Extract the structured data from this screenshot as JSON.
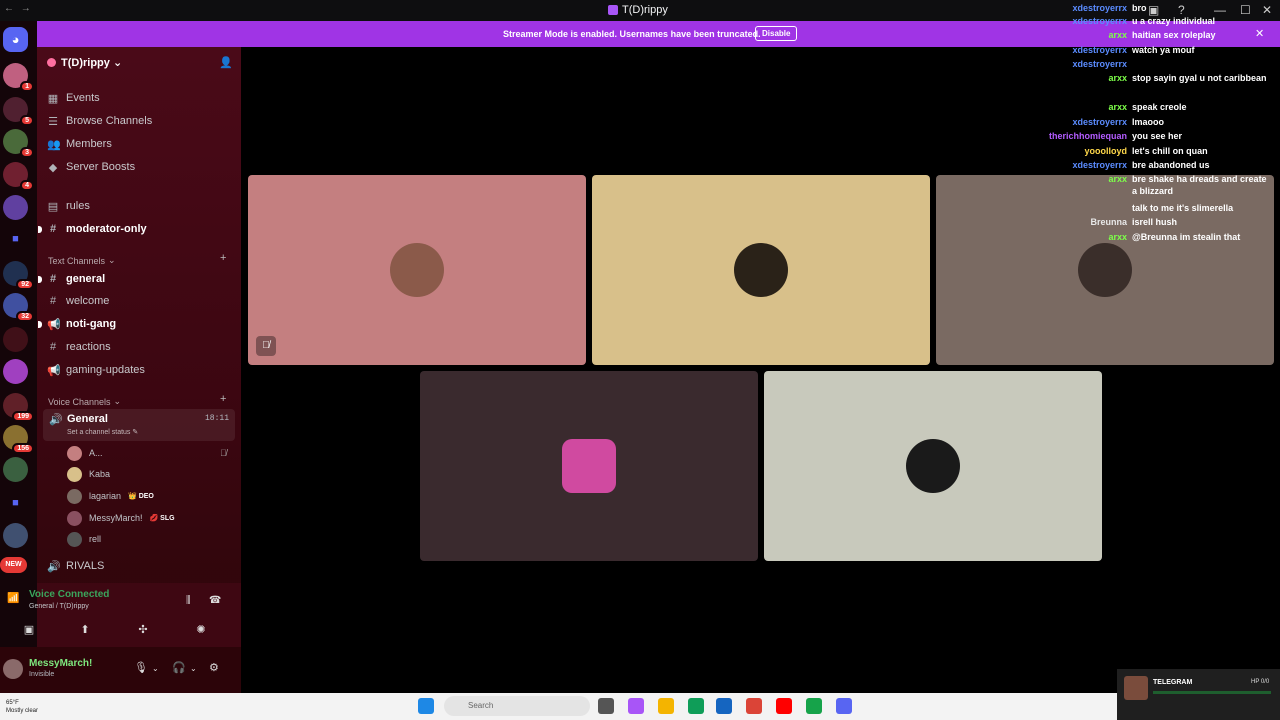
{
  "window": {
    "title": "T(D)rippy"
  },
  "banner": {
    "text": "Streamer Mode is enabled. Usernames have been truncated.",
    "button": "Disable"
  },
  "rail": {
    "badges": [
      "1",
      "5",
      "3",
      "4",
      "92",
      "32",
      "199",
      "156",
      "NEW"
    ]
  },
  "server": {
    "name": "T(D)rippy ⌄"
  },
  "nav": {
    "events": "Events",
    "browse": "Browse Channels",
    "members": "Members",
    "boosts": "Server Boosts",
    "rules": "rules",
    "moderator": "moderator-only"
  },
  "text_channels": {
    "header": "Text Channels",
    "items": [
      "general",
      "welcome",
      "noti-gang",
      "reactions",
      "gaming-updates"
    ]
  },
  "voice_channels": {
    "header": "Voice Channels",
    "general": "General",
    "status": "Set a channel status ✎",
    "time": "18:11",
    "users": [
      {
        "name": "A...",
        "tag": ""
      },
      {
        "name": "Kaba",
        "tag": ""
      },
      {
        "name": "lagarian",
        "tag": "👑 DEO"
      },
      {
        "name": "MessyMarch!",
        "tag": "💋 SLG"
      },
      {
        "name": "rell",
        "tag": ""
      }
    ],
    "rivals": "RIVALS"
  },
  "voice_connected": {
    "title": "Voice Connected",
    "sub": "General / T(D)rippy"
  },
  "user": {
    "name": "MessyMarch!",
    "status": "Invisible"
  },
  "chat": [
    {
      "user": "xdestroyerrx",
      "text": "bro",
      "color": "#5b8cff"
    },
    {
      "user": "xdestroyerrx",
      "text": "u a crazy individual",
      "color": "#5b8cff"
    },
    {
      "user": "arxx",
      "text": "haitian sex roleplay",
      "color": "#7dff4a"
    },
    {
      "user": "xdestroyerrx",
      "text": "watch ya mouf",
      "color": "#5b8cff"
    },
    {
      "user": "xdestroyerrx",
      "text": "",
      "color": "#5b8cff"
    },
    {
      "user": "arxx",
      "text": "stop sayin gyal u not caribbean",
      "color": "#7dff4a"
    },
    {
      "user": "arxx",
      "text": "speak creole",
      "color": "#7dff4a"
    },
    {
      "user": "xdestroyerrx",
      "text": "lmaooo",
      "color": "#5b8cff"
    },
    {
      "user": "therichhomiequan",
      "text": "you see her",
      "color": "#b35cff"
    },
    {
      "user": "yooolloyd",
      "text": "let's chill on quan",
      "color": "#ffd84a"
    },
    {
      "user": "xdestroyerrx",
      "text": "bre abandoned us",
      "color": "#5b8cff"
    },
    {
      "user": "arxx",
      "text": "bre shake ha dreads and create a blizzard",
      "color": "#7dff4a"
    },
    {
      "user": "",
      "text": "talk to me it's slimerella",
      "color": "#3f5fbf"
    },
    {
      "user": "Breunna",
      "text": "isrell hush",
      "color": "#e8e8e8"
    },
    {
      "user": "arxx",
      "text": "@Breunna im stealin that",
      "color": "#7dff4a"
    }
  ],
  "tiles": [
    {
      "bg": "#c47f80",
      "avatar": "#8b5a4a"
    },
    {
      "bg": "#d8c08a",
      "avatar": "#2a2218"
    },
    {
      "bg": "#7a6a62",
      "avatar": "#3a2e2a"
    },
    {
      "bg": "#3a2a2e",
      "avatar": "#d04aa0"
    },
    {
      "bg": "#c8c9bc",
      "avatar": "#1a1a1a"
    }
  ],
  "taskbar": {
    "temp": "65°F",
    "weather": "Mostly clear",
    "search": "Search"
  },
  "telegram": {
    "label": "TELEGRAM",
    "hp": "HP 0/0"
  }
}
